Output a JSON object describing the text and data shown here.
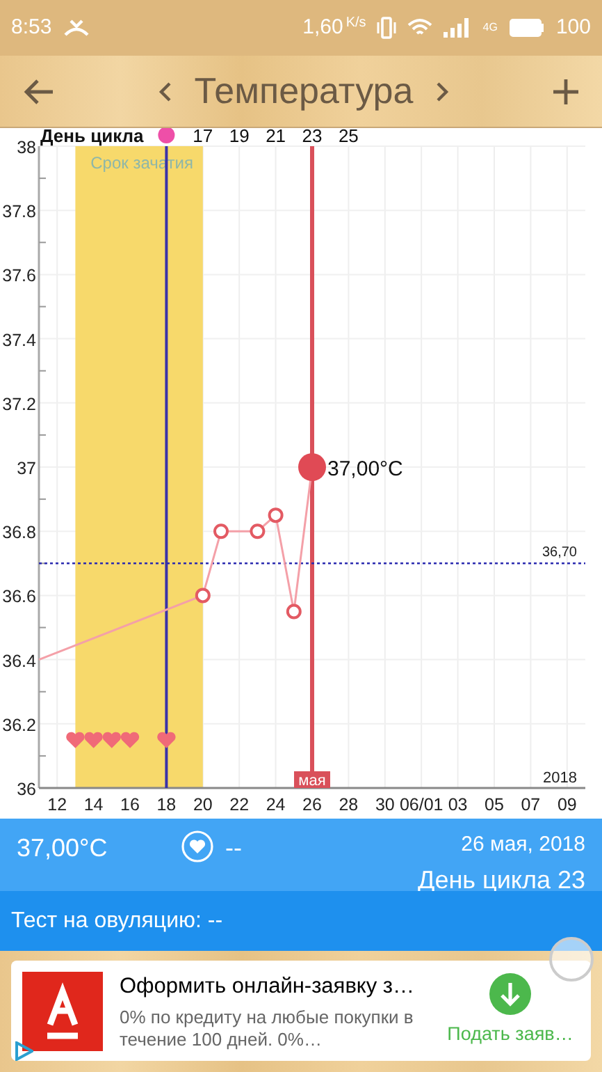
{
  "status_bar": {
    "time": "8:53",
    "speed": "1,60",
    "speed_unit": "K/s",
    "network": "4G",
    "battery": "100"
  },
  "header": {
    "title": "Температура"
  },
  "cycle_axis": {
    "title": "День цикла",
    "days": [
      "17",
      "19",
      "21",
      "23",
      "25"
    ]
  },
  "chart_data": {
    "type": "line",
    "grid": true,
    "x": [
      "2018-05-11",
      "2018-05-13",
      "2018-05-14",
      "2018-05-15",
      "2018-05-16",
      "2018-05-18",
      "2018-05-20",
      "2018-05-21",
      "2018-05-23",
      "2018-05-24",
      "2018-05-25",
      "2018-05-26"
    ],
    "series": [
      {
        "color": "#f4a0a8",
        "marker": "circle",
        "values": [
          36.4,
          null,
          null,
          null,
          null,
          null,
          36.6,
          36.8,
          36.8,
          36.85,
          36.55,
          37.0
        ]
      },
      {
        "type": "scatter",
        "color": "#f06a78",
        "values": [
          null,
          36.15,
          36.15,
          36.15,
          36.15,
          36.15,
          null,
          null,
          null,
          null,
          null,
          null
        ]
      }
    ],
    "xlim": [
      "2018-05-11",
      "2018-06-10"
    ],
    "ylim": [
      36,
      38
    ],
    "xticks": [
      {
        "value": "2018-05-12",
        "label": "12"
      },
      {
        "value": "2018-05-14",
        "label": "14"
      },
      {
        "value": "2018-05-16",
        "label": "16"
      },
      {
        "value": "2018-05-18",
        "label": "18"
      },
      {
        "value": "2018-05-20",
        "label": "20"
      },
      {
        "value": "2018-05-22",
        "label": "22"
      },
      {
        "value": "2018-05-24",
        "label": "24"
      },
      {
        "value": "2018-05-26",
        "label": "26"
      },
      {
        "value": "2018-05-28",
        "label": "28"
      },
      {
        "value": "2018-05-30",
        "label": "30"
      },
      {
        "value": "2018-06-01",
        "label": "06/01"
      },
      {
        "value": "2018-06-03",
        "label": "03"
      },
      {
        "value": "2018-06-05",
        "label": "05"
      },
      {
        "value": "2018-06-07",
        "label": "07"
      },
      {
        "value": "2018-06-09",
        "label": "09"
      }
    ],
    "yticks": [
      {
        "value": 36,
        "label": "36"
      },
      {
        "value": 36.2,
        "label": "36.2"
      },
      {
        "value": 36.4,
        "label": "36.4"
      },
      {
        "value": 36.6,
        "label": "36.6"
      },
      {
        "value": 36.8,
        "label": "36.8"
      },
      {
        "value": 37,
        "label": "37"
      },
      {
        "value": 37.2,
        "label": "37.2"
      },
      {
        "value": 37.4,
        "label": "37.4"
      },
      {
        "value": 37.6,
        "label": "37.6"
      },
      {
        "value": 37.8,
        "label": "37.8"
      },
      {
        "value": 38,
        "label": "38"
      }
    ],
    "bands": [
      {
        "axis": "x",
        "from": "2018-05-13",
        "to": "2018-05-20",
        "label": "Срок зачатия",
        "color": "#f7d96b"
      }
    ],
    "ref_lines": [
      {
        "axis": "x",
        "value": "2018-05-18",
        "color": "#3a32a8"
      },
      {
        "axis": "x",
        "value": "2018-05-26",
        "color": "#d9505a",
        "label": "мая"
      },
      {
        "axis": "y",
        "value": 36.7,
        "color": "#2a2ab0",
        "label": "36,70"
      }
    ],
    "annotations": [
      {
        "text": "37,00°C",
        "x": "2018-05-26",
        "y": 37
      },
      "2018"
    ]
  },
  "summary": {
    "temperature": "37,00°C",
    "mood": "--",
    "date": "26 мая, 2018",
    "cycle_day": "День цикла 23"
  },
  "ovulation_test": "Тест на овуляцию: --",
  "ad": {
    "title": "Оформить онлайн-заявку з…",
    "text": "0% по кредиту на любые покупки в течение 100 дней. 0%…",
    "button": "Подать заяв…"
  }
}
